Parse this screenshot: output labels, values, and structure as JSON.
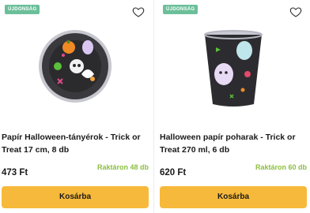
{
  "products": [
    {
      "badge": "ÚJDONSÁG",
      "title": "Papír Halloween-tányérok - Trick or Treat 17 cm, 8 db",
      "stock": "Raktáron 48 db",
      "price": "473 Ft",
      "cart_label": "Kosárba",
      "image_icon": "halloween-plate-image"
    },
    {
      "badge": "ÚJDONSÁG",
      "title": "Halloween papír poharak - Trick or Treat 270 ml, 6 db",
      "stock": "Raktáron 60 db",
      "price": "620 Ft",
      "cart_label": "Kosárba",
      "image_icon": "halloween-cup-image"
    }
  ],
  "colors": {
    "badge": "#6bbf9a",
    "stock": "#8bbf3f",
    "button": "#f7b93b"
  }
}
